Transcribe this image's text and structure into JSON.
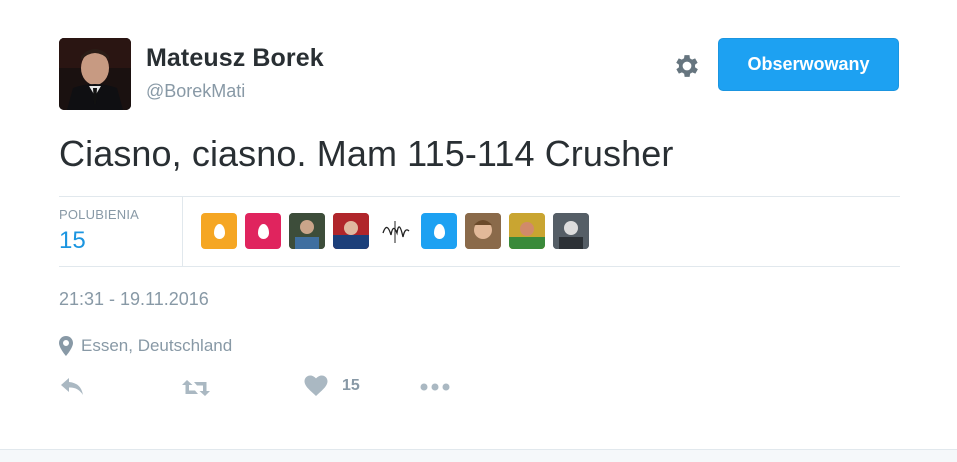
{
  "user": {
    "name": "Mateusz Borek",
    "handle": "@BorekMati"
  },
  "follow_button": {
    "label": "Obserwowany"
  },
  "tweet": {
    "text": "Ciasno, ciasno. Mam 115-114 Crusher"
  },
  "likes": {
    "label": "POLUBIENIA",
    "count": "15",
    "likers": [
      {
        "kind": "egg",
        "color": "#f5a623"
      },
      {
        "kind": "egg",
        "color": "#e0245e"
      },
      {
        "kind": "photo",
        "color": "#556b4f"
      },
      {
        "kind": "photo",
        "color": "#c0392b"
      },
      {
        "kind": "signature",
        "color": "#ffffff"
      },
      {
        "kind": "egg",
        "color": "#1da1f2"
      },
      {
        "kind": "photo",
        "color": "#a0743f"
      },
      {
        "kind": "photo",
        "color": "#d4b23a"
      },
      {
        "kind": "photo",
        "color": "#4a5a6a"
      }
    ]
  },
  "timestamp": "21:31 - 19.11.2016",
  "location": "Essen, Deutschland",
  "actions": {
    "like_count": "15"
  },
  "icons": {
    "settings": "gear-icon",
    "location": "map-pin-icon",
    "reply": "reply-icon",
    "retweet": "retweet-icon",
    "like": "heart-icon",
    "more": "more-icon"
  },
  "colors": {
    "accent": "#1da1f2",
    "muted": "#8899a6",
    "text": "#292f33",
    "count_blue": "#1b95e0"
  }
}
